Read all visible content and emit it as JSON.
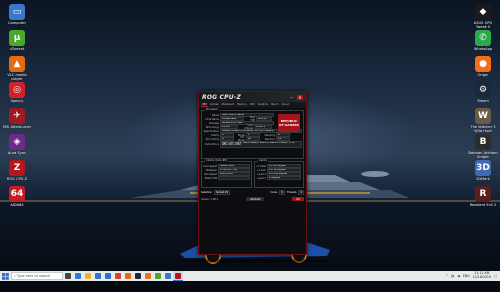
{
  "desktop": {
    "left_icons": [
      {
        "label": "Computer",
        "icon": "computer-icon",
        "color": "#3a78c9",
        "glyph": "▭"
      },
      {
        "label": "uTorrent",
        "icon": "utorrent-icon",
        "color": "#49a82e",
        "glyph": "µ"
      },
      {
        "label": "VLC media player",
        "icon": "vlc-icon",
        "color": "#e46b12",
        "glyph": "▲"
      },
      {
        "label": "Speccy",
        "icon": "speccy-icon",
        "color": "#d21f2a",
        "glyph": "◎"
      },
      {
        "label": "MSI Afterburner",
        "icon": "afterburner-icon",
        "color": "#9c1a20",
        "glyph": "✈"
      },
      {
        "label": "Aura Sync",
        "icon": "aura-icon",
        "color": "#6d2a8a",
        "glyph": "◈"
      },
      {
        "label": "ROG CPU-Z",
        "icon": "rog-cpuz-icon",
        "color": "#b5161c",
        "glyph": "Z"
      },
      {
        "label": "AIDA64",
        "icon": "aida64-icon",
        "color": "#c41d24",
        "glyph": "64"
      }
    ],
    "right_icons": [
      {
        "label": "ASUS GPU Tweak II",
        "icon": "gpu-tweak-icon",
        "color": "#1a1a1a",
        "glyph": "◆"
      },
      {
        "label": "WhatsApp",
        "icon": "whatsapp-icon",
        "color": "#2aa84a",
        "glyph": "✆"
      },
      {
        "label": "Origin",
        "icon": "origin-icon",
        "color": "#f56c1b",
        "glyph": "●"
      },
      {
        "label": "Steam",
        "icon": "steam-icon",
        "color": "#1b2838",
        "glyph": "⚙"
      },
      {
        "label": "The Witcher 3 Wild Hunt",
        "icon": "witcher-icon",
        "color": "#6a5b45",
        "glyph": "W"
      },
      {
        "label": "Batman Arkham Knight",
        "icon": "batman-icon",
        "color": "#2b2b2b",
        "glyph": "B"
      },
      {
        "label": "3DMark",
        "icon": "3dmark-icon",
        "color": "#3e6bb3",
        "glyph": "3D"
      },
      {
        "label": "Resident Evil 2",
        "icon": "re2-icon",
        "color": "#5a1e1e",
        "glyph": "R"
      }
    ]
  },
  "cpuz": {
    "title": "ROG CPU-Z",
    "tabs": [
      "CPU",
      "Caches",
      "Mainboard",
      "Memory",
      "SPD",
      "Graphics",
      "Bench",
      "About"
    ],
    "active_tab": "CPU",
    "processor_legend": "Processor",
    "name_label": "Name",
    "name_value": "Intel Core i5 9400F",
    "codename_label": "Code Name",
    "codename_value": "Coffee Lake",
    "maxtdp_label": "Max TDP",
    "maxtdp_value": "65.0 W",
    "package_label": "Package",
    "package_value": "Socket 1151 LGA",
    "technology_label": "Technology",
    "technology_value": "14 nm",
    "voltage_label": "Core Voltage",
    "voltage_value": "1.056 V",
    "spec_label": "Specification",
    "spec_value": "Intel(R) Core(TM) i5-9400F CPU @ 2.90GHz",
    "family_label": "Family",
    "family_value": "6",
    "model_label": "Model",
    "model_value": "E",
    "stepping_label": "Stepping",
    "stepping_value": "A",
    "extfamily_label": "Ext. Family",
    "extfamily_value": "6",
    "extmodel_label": "Ext. Model",
    "extmodel_value": "9E",
    "revision_label": "Revision",
    "revision_value": "U0",
    "instructions_label": "Instructions",
    "instructions_value": "MMX, SSE, SSE2, SSE3, SSSE3, SSE4.1, SSE4.2, EM64T, VT-x, AES, AVX, AVX2",
    "clocks_legend": "Clocks (Core #0)",
    "corespeed_label": "Core Speed",
    "corespeed_value": "3900.4 MHz",
    "multiplier_label": "Multiplier",
    "multiplier_value": "x 39.0 (8 - 41)",
    "busspeed_label": "Bus Speed",
    "busspeed_value": "100.0 MHz",
    "ratedfsb_label": "Rated FSB",
    "ratedfsb_value": "",
    "cache_legend": "Cache",
    "l1d_label": "L1 Data",
    "l1d_value": "6 x 32 KBytes",
    "l1i_label": "L1 Inst.",
    "l1i_value": "6 x 32 KBytes",
    "l2_label": "Level 2",
    "l2_value": "6 x 256 KBytes",
    "l3_label": "Level 3",
    "l3_value": "9 MBytes",
    "selection_label": "Selection",
    "selection_value": "Socket #1",
    "cores_label": "Cores",
    "cores_value": "6",
    "threads_label": "Threads",
    "threads_value": "6",
    "version": "Version 1.88.1",
    "validate_label": "Validate",
    "ok_label": "OK",
    "rog_badge": "REPUBLIC OF GAMERS"
  },
  "taskbar": {
    "search_placeholder": "Type here to search",
    "apps": [
      {
        "name": "task-view",
        "color": "#444"
      },
      {
        "name": "edge",
        "color": "#2f7bd6"
      },
      {
        "name": "file-explorer",
        "color": "#e9b32c"
      },
      {
        "name": "store",
        "color": "#2f6fd6"
      },
      {
        "name": "mail",
        "color": "#2f6fd6"
      },
      {
        "name": "chrome",
        "color": "#d94030"
      },
      {
        "name": "vlc",
        "color": "#e46b12"
      },
      {
        "name": "steam",
        "color": "#1b2838"
      },
      {
        "name": "origin",
        "color": "#f56c1b"
      },
      {
        "name": "utorrent",
        "color": "#49a82e"
      },
      {
        "name": "photos",
        "color": "#3a78c9"
      },
      {
        "name": "rog-cpuz",
        "color": "#b5161c",
        "active": true
      }
    ],
    "language": "ENG",
    "time": "11:12 AM",
    "date": "12/16/2019"
  }
}
